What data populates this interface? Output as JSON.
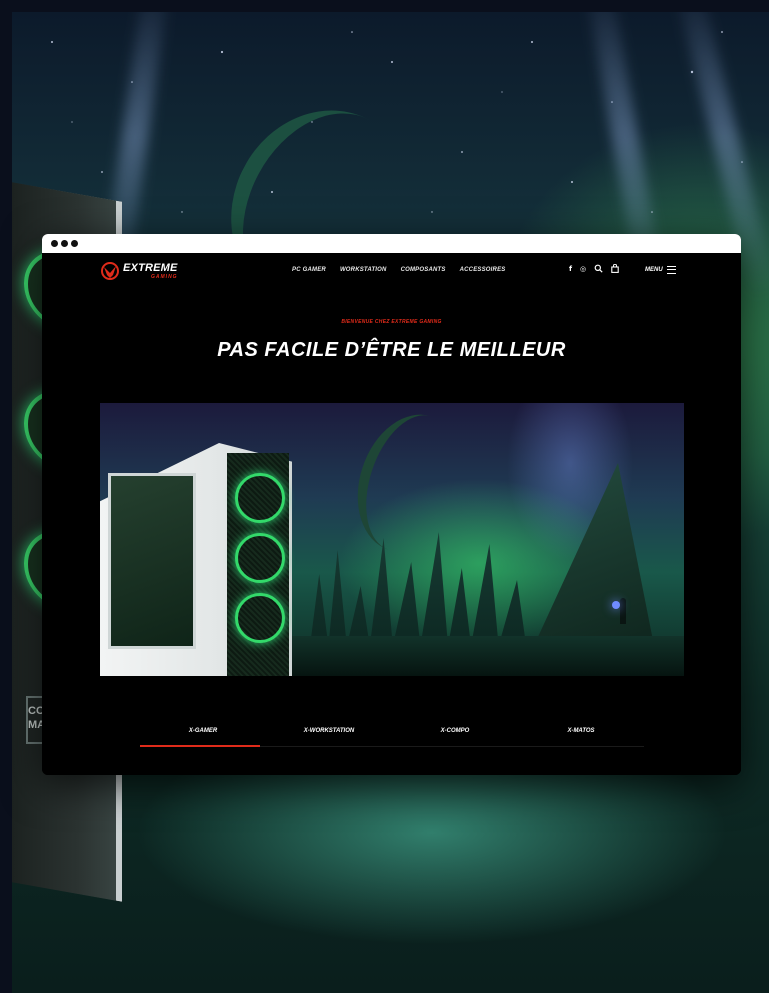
{
  "brand": {
    "name": "EXTREME",
    "subname": "GAMING",
    "accent_color": "#e02b1a"
  },
  "nav": {
    "links": [
      "PC GAMER",
      "WORKSTATION",
      "COMPOSANTS",
      "ACCESSOIRES"
    ],
    "icons": [
      "facebook-icon",
      "instagram-icon",
      "search-icon",
      "bag-icon"
    ],
    "menu_label": "MENU"
  },
  "hero": {
    "eyebrow": "BIENVENUE CHEZ EXTREME GAMING",
    "headline": "PAS FACILE D’ÊTRE LE MEILLEUR"
  },
  "tabs": {
    "items": [
      "X-GAMER",
      "X-WORKSTATION",
      "X-COMPO",
      "X-MATOS"
    ],
    "active": "X-GAMER"
  },
  "backdrop": {
    "case_logo": "COOLER MASTER"
  }
}
